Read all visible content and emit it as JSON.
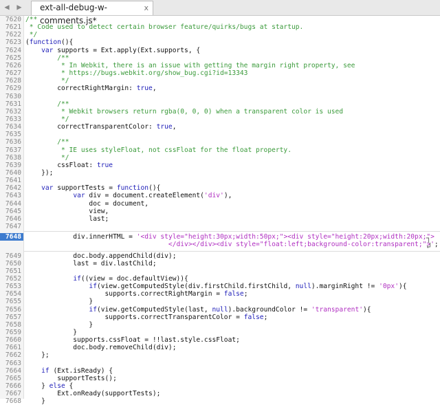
{
  "tab": {
    "title": "ext-all-debug-w-comments.js*",
    "close": "x",
    "nav_left": "◀",
    "nav_right": "▶"
  },
  "gutter": {
    "active_line": "7648"
  },
  "lines": [
    {
      "n": "7620",
      "t": [
        [
          "cm",
          "/**"
        ]
      ]
    },
    {
      "n": "7621",
      "t": [
        [
          "cm",
          " * Code used to detect certain browser feature/quirks/bugs at startup."
        ]
      ]
    },
    {
      "n": "7622",
      "t": [
        [
          "cm",
          " */"
        ]
      ]
    },
    {
      "n": "7623",
      "t": [
        [
          "",
          "("
        ],
        [
          "kw",
          "function"
        ],
        [
          "",
          "(){"
        ]
      ]
    },
    {
      "n": "7624",
      "t": [
        [
          "",
          "    "
        ],
        [
          "kw",
          "var"
        ],
        [
          "",
          " supports = Ext.apply(Ext.supports, {"
        ]
      ]
    },
    {
      "n": "7625",
      "t": [
        [
          "cm",
          "        /**"
        ]
      ]
    },
    {
      "n": "7626",
      "t": [
        [
          "cm",
          "         * In Webkit, there is an issue with getting the margin right property, see"
        ]
      ]
    },
    {
      "n": "7627",
      "t": [
        [
          "cm",
          "         * https://bugs.webkit.org/show_bug.cgi?id=13343"
        ]
      ]
    },
    {
      "n": "7628",
      "t": [
        [
          "cm",
          "         */"
        ]
      ]
    },
    {
      "n": "7629",
      "t": [
        [
          "",
          "        correctRightMargin: "
        ],
        [
          "kw",
          "true"
        ],
        [
          "",
          ","
        ]
      ]
    },
    {
      "n": "7630",
      "t": [
        [
          "",
          ""
        ]
      ]
    },
    {
      "n": "7631",
      "t": [
        [
          "cm",
          "        /**"
        ]
      ]
    },
    {
      "n": "7632",
      "t": [
        [
          "cm",
          "         * Webkit browsers return rgba(0, 0, 0) when a transparent color is used"
        ]
      ]
    },
    {
      "n": "7633",
      "t": [
        [
          "cm",
          "         */"
        ]
      ]
    },
    {
      "n": "7634",
      "t": [
        [
          "",
          "        correctTransparentColor: "
        ],
        [
          "kw",
          "true"
        ],
        [
          "",
          ","
        ]
      ]
    },
    {
      "n": "7635",
      "t": [
        [
          "",
          ""
        ]
      ]
    },
    {
      "n": "7636",
      "t": [
        [
          "cm",
          "        /**"
        ]
      ]
    },
    {
      "n": "7637",
      "t": [
        [
          "cm",
          "         * IE uses styleFloat, not cssFloat for the float property."
        ]
      ]
    },
    {
      "n": "7638",
      "t": [
        [
          "cm",
          "         */"
        ]
      ]
    },
    {
      "n": "7639",
      "t": [
        [
          "",
          "        cssFloat: "
        ],
        [
          "kw",
          "true"
        ]
      ]
    },
    {
      "n": "7640",
      "t": [
        [
          "",
          "    });"
        ]
      ]
    },
    {
      "n": "7641",
      "t": [
        [
          "",
          ""
        ]
      ]
    },
    {
      "n": "7642",
      "t": [
        [
          "",
          "    "
        ],
        [
          "kw",
          "var"
        ],
        [
          "",
          " supportTests = "
        ],
        [
          "kw",
          "function"
        ],
        [
          "",
          "(){"
        ]
      ]
    },
    {
      "n": "7643",
      "t": [
        [
          "",
          "            "
        ],
        [
          "kw",
          "var"
        ],
        [
          "",
          " div = document.createElement("
        ],
        [
          "st",
          "'div'"
        ],
        [
          "",
          "),"
        ]
      ]
    },
    {
      "n": "7644",
      "t": [
        [
          "",
          "                doc = document,"
        ]
      ]
    },
    {
      "n": "7645",
      "t": [
        [
          "",
          "                view,"
        ]
      ]
    },
    {
      "n": "7646",
      "t": [
        [
          "",
          "                last;"
        ]
      ]
    },
    {
      "n": "7647",
      "t": [
        [
          "",
          ""
        ]
      ]
    },
    {
      "n": "7648",
      "t": [
        [
          "",
          "            div.innerHTML = "
        ],
        [
          "st",
          "'<div style=\"height:30px;width:50px;\"><div style=\"height:20px;width:20px;\">"
        ]
      ],
      "wrap": [
        [
          "st",
          "                                    </div></div><div style=\"float:left;background-color:transparent;\">'"
        ],
        [
          "",
          ";"
        ]
      ]
    },
    {
      "n": "7649",
      "t": [
        [
          "",
          "            doc.body.appendChild(div);"
        ]
      ]
    },
    {
      "n": "7650",
      "t": [
        [
          "",
          "            last = div.lastChild;"
        ]
      ]
    },
    {
      "n": "7651",
      "t": [
        [
          "",
          ""
        ]
      ]
    },
    {
      "n": "7652",
      "t": [
        [
          "",
          "            "
        ],
        [
          "kw",
          "if"
        ],
        [
          "",
          "((view = doc.defaultView)){"
        ]
      ]
    },
    {
      "n": "7653",
      "t": [
        [
          "",
          "                "
        ],
        [
          "kw",
          "if"
        ],
        [
          "",
          "(view.getComputedStyle(div.firstChild.firstChild, "
        ],
        [
          "kw",
          "null"
        ],
        [
          "",
          ").marginRight != "
        ],
        [
          "st",
          "'0px'"
        ],
        [
          "",
          "){"
        ]
      ]
    },
    {
      "n": "7654",
      "t": [
        [
          "",
          "                    supports.correctRightMargin = "
        ],
        [
          "kw",
          "false"
        ],
        [
          "",
          ";"
        ]
      ]
    },
    {
      "n": "7655",
      "t": [
        [
          "",
          "                }"
        ]
      ]
    },
    {
      "n": "7656",
      "t": [
        [
          "",
          "                "
        ],
        [
          "kw",
          "if"
        ],
        [
          "",
          "(view.getComputedStyle(last, "
        ],
        [
          "kw",
          "null"
        ],
        [
          "",
          ").backgroundColor != "
        ],
        [
          "st",
          "'transparent'"
        ],
        [
          "",
          "){"
        ]
      ]
    },
    {
      "n": "7657",
      "t": [
        [
          "",
          "                    supports.correctTransparentColor = "
        ],
        [
          "kw",
          "false"
        ],
        [
          "",
          ";"
        ]
      ]
    },
    {
      "n": "7658",
      "t": [
        [
          "",
          "                }"
        ]
      ]
    },
    {
      "n": "7659",
      "t": [
        [
          "",
          "            }"
        ]
      ]
    },
    {
      "n": "7660",
      "t": [
        [
          "",
          "            supports.cssFloat = !!last.style.cssFloat;"
        ]
      ]
    },
    {
      "n": "7661",
      "t": [
        [
          "",
          "            doc.body.removeChild(div);"
        ]
      ]
    },
    {
      "n": "7662",
      "t": [
        [
          "",
          "    };"
        ]
      ]
    },
    {
      "n": "7663",
      "t": [
        [
          "",
          ""
        ]
      ]
    },
    {
      "n": "7664",
      "t": [
        [
          "",
          "    "
        ],
        [
          "kw",
          "if"
        ],
        [
          "",
          " (Ext.isReady) {"
        ]
      ]
    },
    {
      "n": "7665",
      "t": [
        [
          "",
          "        supportTests();"
        ]
      ]
    },
    {
      "n": "7666",
      "t": [
        [
          "",
          "    } "
        ],
        [
          "kw",
          "else"
        ],
        [
          "",
          " {"
        ]
      ]
    },
    {
      "n": "7667",
      "t": [
        [
          "",
          "        Ext.onReady(supportTests);"
        ]
      ]
    },
    {
      "n": "7668",
      "t": [
        [
          "",
          "    }"
        ]
      ]
    }
  ]
}
